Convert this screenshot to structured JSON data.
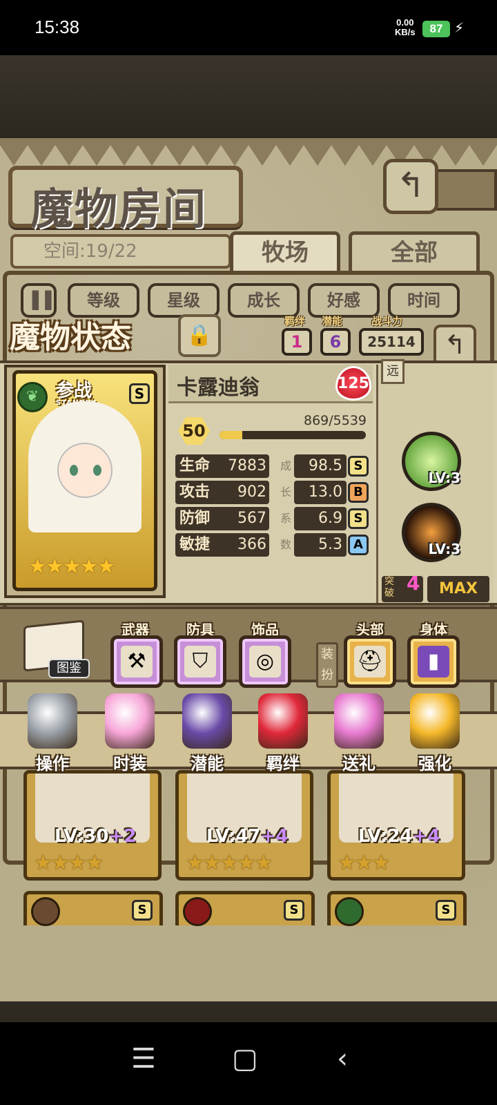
{
  "status_bar": {
    "time": "15:38",
    "net_speed_value": "0.00",
    "net_speed_unit": "KB/s",
    "battery": "87"
  },
  "room": {
    "title": "魔物房间",
    "space_label": "空间:19/22",
    "tabs": [
      "牧场",
      "全部"
    ],
    "sort_buttons": [
      "等级",
      "星级",
      "成长",
      "好感",
      "时间"
    ]
  },
  "monster": {
    "panel_title": "魔物状态",
    "bond_label": "羁绊",
    "bond_value": "1",
    "potential_label": "潜能",
    "potential_value": "6",
    "power_label": "战斗力",
    "power_value": "25114",
    "card_badge": "参战",
    "card_badge_sub": "STANDBY",
    "card_grade": "S",
    "stars": "★★★★★",
    "name": "卡露迪翁",
    "affection": "125",
    "level": "50",
    "exp_text": "869/5539",
    "exp_progress": 0.157,
    "growth_vertical_label": [
      "成",
      "长",
      "系",
      "数"
    ],
    "stats": [
      {
        "label": "生命",
        "value": "7883",
        "growth": "98.5",
        "grade": "S",
        "grade_color": "#f2e08a"
      },
      {
        "label": "攻击",
        "value": "902",
        "growth": "13.0",
        "grade": "B",
        "grade_color": "#f0a45a"
      },
      {
        "label": "防御",
        "value": "567",
        "growth": "6.9",
        "grade": "S",
        "grade_color": "#f2e08a"
      },
      {
        "label": "敏捷",
        "value": "366",
        "growth": "5.3",
        "grade": "A",
        "grade_color": "#8ac8f2"
      }
    ],
    "range": "远",
    "skills": [
      {
        "name": "leaf-skill-icon",
        "level": "LV:3",
        "color": "#6fcf3a"
      },
      {
        "name": "fire-sword-skill-icon",
        "level": "LV:3",
        "color": "#e06a1a"
      }
    ],
    "breakthrough_label": "突破",
    "breakthrough_value": "4",
    "max_label": "MAX"
  },
  "equipment": {
    "codex_label": "图鉴",
    "dress_label": "装扮",
    "slots": [
      {
        "label": "武器",
        "icon": "scythe-icon"
      },
      {
        "label": "防具",
        "icon": "cloak-icon"
      },
      {
        "label": "饰品",
        "icon": "ring-icon"
      },
      {
        "label": "头部",
        "icon": "headband-icon"
      },
      {
        "label": "身体",
        "icon": "book-icon"
      }
    ]
  },
  "actions": [
    {
      "label": "操作",
      "icon": "gear-icon",
      "color": "#9aa0a8"
    },
    {
      "label": "时装",
      "icon": "outfit-icon",
      "color": "#f7a6d8"
    },
    {
      "label": "潜能",
      "icon": "demon-icon",
      "color": "#6a4aa8"
    },
    {
      "label": "羁绊",
      "icon": "hearts-icon",
      "color": "#e0283a"
    },
    {
      "label": "送礼",
      "icon": "gift-icon",
      "color": "#e87ad0"
    },
    {
      "label": "强化",
      "icon": "arrow-up-icon",
      "color": "#f5b82a"
    }
  ],
  "monster_list": [
    {
      "level": "LV:30",
      "bonus": "+2",
      "stars": "★★★★"
    },
    {
      "level": "LV:47",
      "bonus": "+4",
      "stars": "★★★★★"
    },
    {
      "level": "LV:24",
      "bonus": "+4",
      "stars": "★★★"
    }
  ],
  "monster_list_row2": [
    {
      "element_color": "#6a4a30",
      "grade": "S"
    },
    {
      "element_color": "#8a1a1a",
      "grade": "S"
    },
    {
      "element_color": "#2f6a2f",
      "grade": "S"
    }
  ]
}
